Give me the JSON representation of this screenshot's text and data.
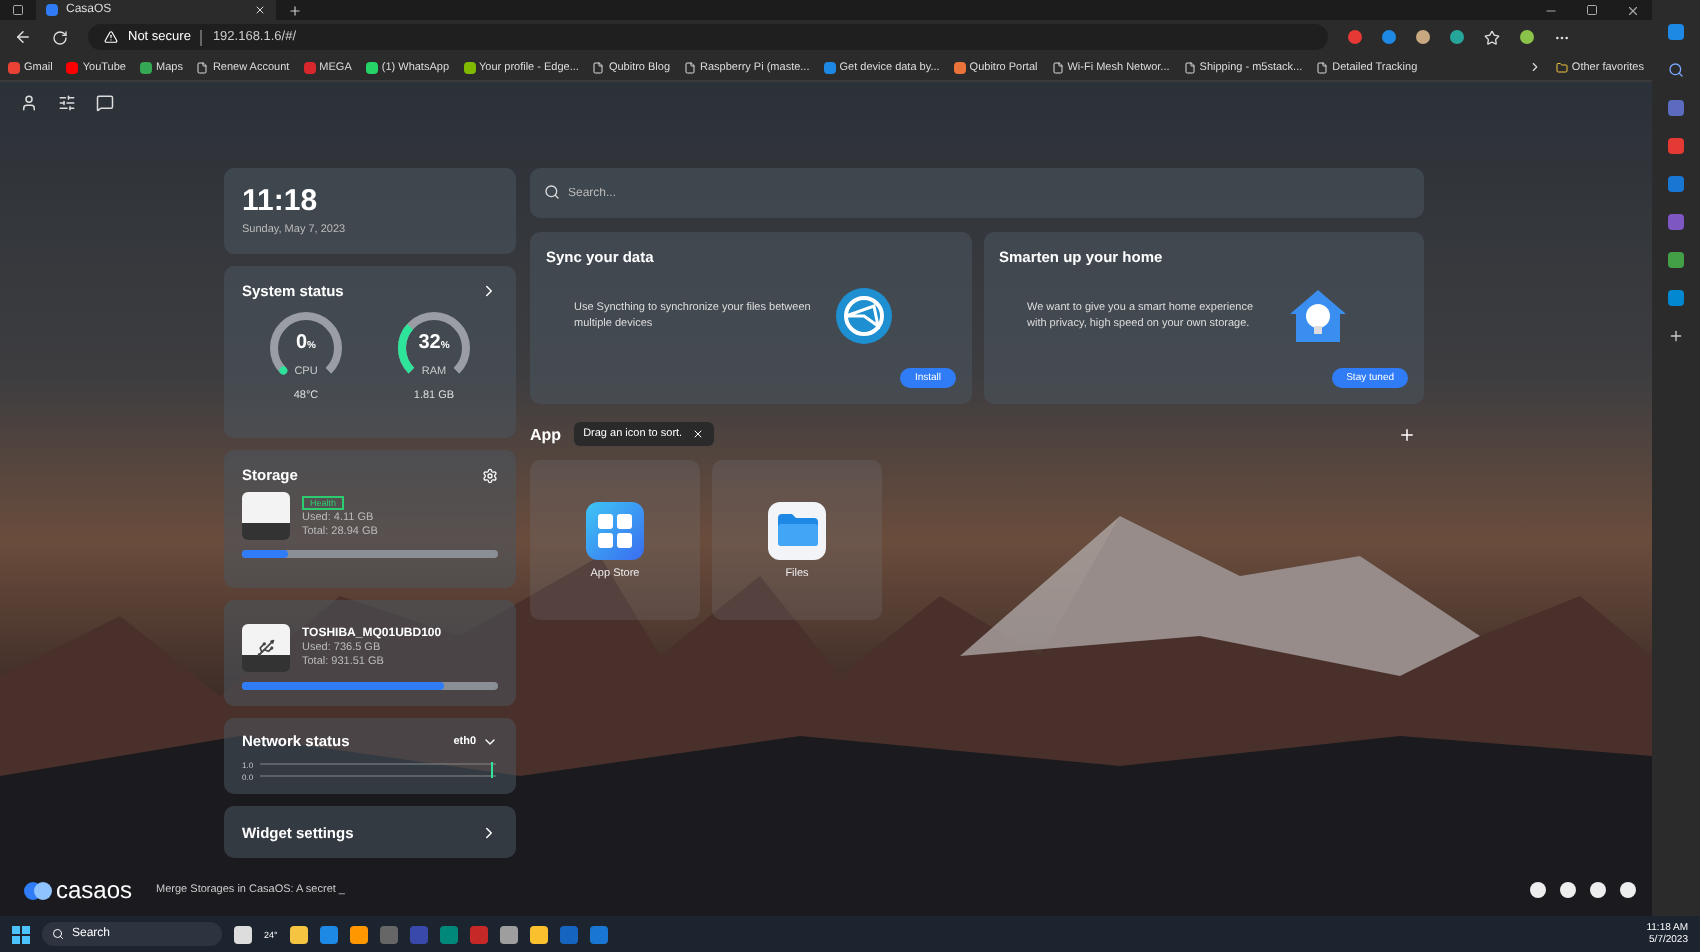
{
  "browser": {
    "tab_title": "CasaOS",
    "security": "Not secure",
    "url": "192.168.1.6/#/",
    "bookmarks": [
      {
        "label": "Gmail",
        "kind": "site",
        "color": "#ea4335"
      },
      {
        "label": "YouTube",
        "kind": "site",
        "color": "#ff0000"
      },
      {
        "label": "Maps",
        "kind": "site",
        "color": "#34a853"
      },
      {
        "label": "Renew Account",
        "kind": "page"
      },
      {
        "label": "MEGA",
        "kind": "site",
        "color": "#d9272e"
      },
      {
        "label": "(1) WhatsApp",
        "kind": "site",
        "color": "#25d366"
      },
      {
        "label": "Your profile - Edge...",
        "kind": "site",
        "color": "#7fba00"
      },
      {
        "label": "Qubitro Blog",
        "kind": "page"
      },
      {
        "label": "Raspberry Pi (maste...",
        "kind": "page"
      },
      {
        "label": "Get device data by...",
        "kind": "site",
        "color": "#1e88e5"
      },
      {
        "label": "Qubitro Portal",
        "kind": "site",
        "color": "#e8743b"
      },
      {
        "label": "Wi-Fi Mesh Networ...",
        "kind": "page"
      },
      {
        "label": "Shipping - m5stack...",
        "kind": "page"
      },
      {
        "label": "Detailed Tracking",
        "kind": "page"
      }
    ],
    "other_favorites": "Other favorites"
  },
  "clock": {
    "time": "11:18",
    "date": "Sunday, May 7, 2023"
  },
  "system_status": {
    "title": "System status",
    "gauges": [
      {
        "label": "CPU",
        "value": "0",
        "unit": "%",
        "reading": "48°C",
        "level": 0
      },
      {
        "label": "RAM",
        "value": "32",
        "unit": "%",
        "reading": "1.81 GB",
        "level": 0.32
      }
    ]
  },
  "storage": {
    "title": "Storage",
    "disks": [
      {
        "kind": "internal",
        "badge": "Health",
        "used": "Used: 4.11 GB",
        "total": "Total: 28.94 GB",
        "level": 0.18
      },
      {
        "kind": "usb",
        "name": "TOSHIBA_MQ01UBD100",
        "used": "Used: 736.5 GB",
        "total": "Total: 931.51 GB",
        "level": 0.79
      }
    ]
  },
  "network_status": {
    "title": "Network status",
    "interface": "eth0",
    "ticks": [
      "1.0",
      "0.0"
    ]
  },
  "widget_settings": {
    "title": "Widget settings"
  },
  "search": {
    "placeholder": "Search..."
  },
  "cards": [
    {
      "kind": "sync",
      "title": "Sync your data",
      "text": "Use Syncthing to synchronize your files between multiple devices",
      "button": "Install"
    },
    {
      "kind": "home",
      "title": "Smarten up your home",
      "text": "We want to give you a smart home experience with privacy, high speed on your own storage.",
      "button": "Stay tuned"
    }
  ],
  "apps": {
    "title": "App",
    "tooltip": "Drag an icon to sort.",
    "items": [
      {
        "kind": "appstore",
        "name": "App Store"
      },
      {
        "kind": "files",
        "name": "Files"
      }
    ]
  },
  "footer": {
    "brand": "casaos",
    "news": "Merge Storages in CasaOS: A secret _"
  },
  "taskbar": {
    "search": "Search",
    "weather": "24°",
    "time": "11:18 AM",
    "date": "5/7/2023"
  }
}
